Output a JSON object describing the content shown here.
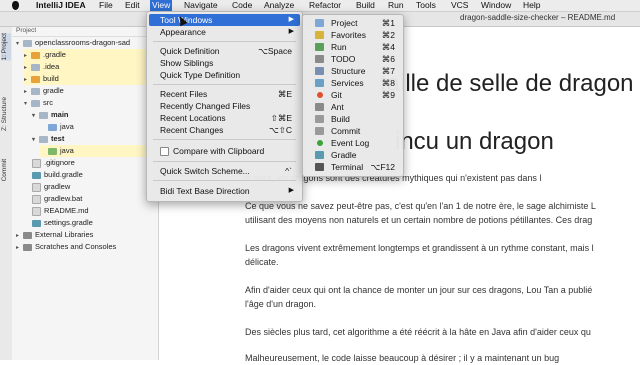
{
  "menubar": {
    "app_name": "IntelliJ IDEA",
    "items": [
      "File",
      "Edit",
      "View",
      "Navigate",
      "Code",
      "Analyze",
      "Refactor",
      "Build",
      "Run",
      "Tools",
      "VCS",
      "Window",
      "Help"
    ]
  },
  "window_title": "dragon-saddle-size-checker – README.md",
  "toolstrip": {
    "project_tab": "1: Project",
    "structure_tab": "Z: Structure",
    "commit_tab": "Commit"
  },
  "project_panel": {
    "header": "Project",
    "tree": [
      {
        "label": "openclassrooms-dragon-sad"
      },
      {
        "label": ".gradle"
      },
      {
        "label": ".idea"
      },
      {
        "label": "build"
      },
      {
        "label": "gradle"
      },
      {
        "label": "src"
      },
      {
        "label": "main"
      },
      {
        "label": "java"
      },
      {
        "label": "test"
      },
      {
        "label": "java"
      },
      {
        "label": ".gitignore"
      },
      {
        "label": "build.gradle"
      },
      {
        "label": "gradlew"
      },
      {
        "label": "gradlew.bat"
      },
      {
        "label": "README.md"
      },
      {
        "label": "settings.gradle"
      },
      {
        "label": "External Libraries"
      },
      {
        "label": "Scratches and Consoles"
      }
    ]
  },
  "view_menu": {
    "items": [
      {
        "label": "Tool Windows",
        "shortcut": ""
      },
      {
        "label": "Appearance",
        "shortcut": ""
      },
      {
        "label": "Quick Definition",
        "shortcut": "⌥Space"
      },
      {
        "label": "Show Siblings",
        "shortcut": ""
      },
      {
        "label": "Quick Type Definition",
        "shortcut": ""
      },
      {
        "label": "Recent Files",
        "shortcut": "⌘E"
      },
      {
        "label": "Recently Changed Files",
        "shortcut": ""
      },
      {
        "label": "Recent Locations",
        "shortcut": "⇧⌘E"
      },
      {
        "label": "Recent Changes",
        "shortcut": "⌥⇧C"
      },
      {
        "label": "Compare with Clipboard",
        "shortcut": ""
      },
      {
        "label": "Quick Switch Scheme...",
        "shortcut": "^`"
      },
      {
        "label": "Bidi Text Base Direction",
        "shortcut": ""
      }
    ]
  },
  "tool_windows_menu": {
    "items": [
      {
        "label": "Project",
        "shortcut": "⌘1"
      },
      {
        "label": "Favorites",
        "shortcut": "⌘2"
      },
      {
        "label": "Run",
        "shortcut": "⌘4"
      },
      {
        "label": "TODO",
        "shortcut": "⌘6"
      },
      {
        "label": "Structure",
        "shortcut": "⌘7"
      },
      {
        "label": "Services",
        "shortcut": "⌘8"
      },
      {
        "label": "Git",
        "shortcut": "⌘9"
      },
      {
        "label": "Ant",
        "shortcut": ""
      },
      {
        "label": "Build",
        "shortcut": ""
      },
      {
        "label": "Commit",
        "shortcut": ""
      },
      {
        "label": "Event Log",
        "shortcut": ""
      },
      {
        "label": "Gradle",
        "shortcut": ""
      },
      {
        "label": "Terminal",
        "shortcut": "⌥F12"
      }
    ]
  },
  "editor": {
    "heading1": "taille de selle de dragon",
    "heading2": "incu un dragon",
    "paragraphs": [
      "n salut, les dragons sont des créatures mythiques qui n'existent pas dans l",
      "Ce que vous ne savez peut-être pas, c'est qu'en l'an 1 de notre ère, le sage alchimiste L",
      "utilisant des moyens non naturels et un certain nombre de potions pétillantes. Ces drag",
      "Les dragons vivent extrêmement longtemps et grandissent à un rythme constant, mais l",
      "délicate.",
      "Afin d'aider ceux qui ont la chance de monter un jour sur ces dragons, Lou Tan a publié",
      "l'âge d'un dragon.",
      "Des siècles plus tard, cet algorithme a été réécrit à la hâte en Java afin d'aider ceux qu",
      "Malheureusement, le code laisse beaucoup à désirer ; il y a maintenant un bug"
    ]
  },
  "colors": {
    "menu_highlight": "#2f6fd6",
    "git_dot": "#e0502f",
    "event_log_dot": "#3aa43a"
  }
}
